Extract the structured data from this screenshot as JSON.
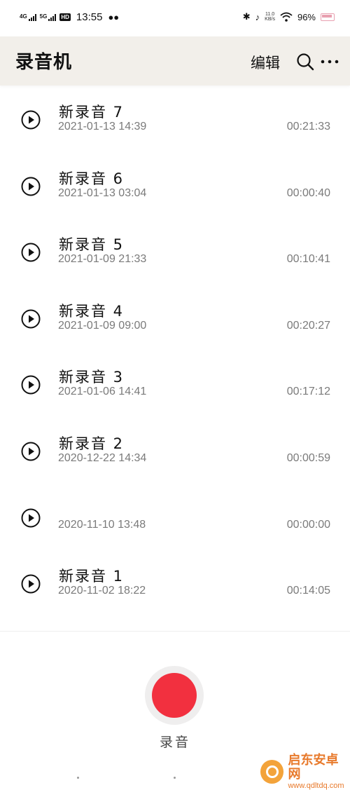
{
  "status_bar": {
    "network_1": "4G",
    "network_2": "5G",
    "hd_badge": "HD",
    "time": "13:55",
    "wechat_icon": "wechat-icon",
    "speed_value": "11.0",
    "speed_unit": "KB/s",
    "battery": "96%",
    "accent_color": "#e8a0b0"
  },
  "app_bar": {
    "title": "录音机",
    "edit_label": "编辑",
    "search_icon": "search-icon",
    "more_icon": "more-icon",
    "background": "#f2efea"
  },
  "recordings": [
    {
      "title": "新录音 7",
      "date": "2021-01-13  14:39",
      "duration": "00:21:33"
    },
    {
      "title": "新录音 6",
      "date": "2021-01-13  03:04",
      "duration": "00:00:40"
    },
    {
      "title": "新录音 5",
      "date": "2021-01-09  21:33",
      "duration": "00:10:41"
    },
    {
      "title": "新录音 4",
      "date": "2021-01-09  09:00",
      "duration": "00:20:27"
    },
    {
      "title": "新录音 3",
      "date": "2021-01-06  14:41",
      "duration": "00:17:12"
    },
    {
      "title": "新录音 2",
      "date": "2020-12-22  14:34",
      "duration": "00:00:59"
    },
    {
      "title": "",
      "date": "2020-11-10  13:48",
      "duration": "00:00:00"
    },
    {
      "title": "新录音 1",
      "date": "2020-11-02  18:22",
      "duration": "00:14:05"
    }
  ],
  "record_button": {
    "label": "录音",
    "color": "#f2303f"
  },
  "watermark": {
    "name": "启东安卓网",
    "url": "www.qdltdq.com"
  }
}
